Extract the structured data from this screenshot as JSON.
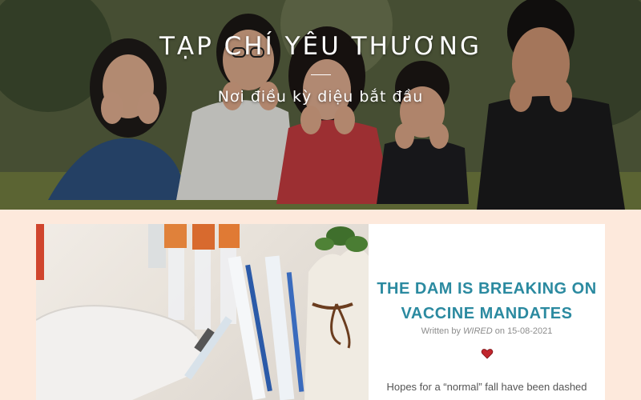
{
  "hero": {
    "title": "TẠP CHÍ YÊU THƯƠNG",
    "subtitle": "Nơi điều kỳ diệu bắt đầu"
  },
  "post": {
    "title_line1": "THE DAM IS BREAKING ON",
    "title_line2": "VACCINE MANDATES",
    "meta_prefix": "Written by",
    "author": "WIRED",
    "meta_on": "on",
    "date": "15-08-2021",
    "excerpt": "Hopes for a “normal” fall have been dashed",
    "heart_icon": "heart-icon"
  },
  "colors": {
    "page_bg": "#fde9dc",
    "title": "#2b8aa0",
    "heart": "#c0262d"
  }
}
